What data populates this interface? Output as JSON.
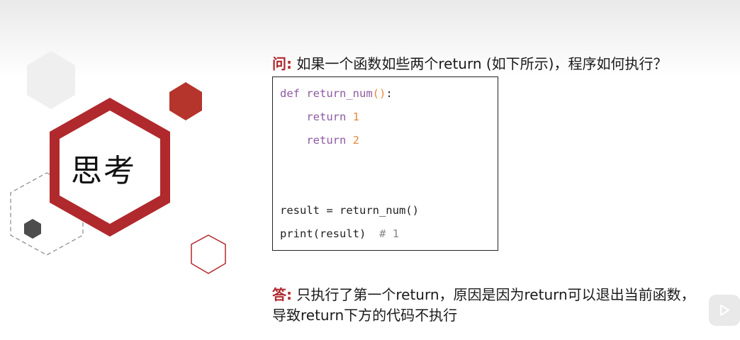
{
  "center_label": "思考",
  "question": {
    "tag": "问:",
    "text": " 如果一个函数如些两个return (如下所示)，程序如何执行？"
  },
  "code": {
    "line1_kw": "def",
    "line1_fn": "return_num",
    "line1_paren": "()",
    "line1_colon": ":",
    "line2_kw": "return",
    "line2_num": "1",
    "line3_kw": "return",
    "line3_num": "2",
    "line4": "result = return_num()",
    "line5": "print(result)",
    "line5_comment": "# 1"
  },
  "answer": {
    "tag": "答:",
    "text1": " 只执行了第一个return，原因是因为return可以退出当前函数，",
    "text2": "导致return下方的代码不执行"
  },
  "colors": {
    "accent_red": "#b0292d",
    "keyword_purple": "#8e5aa0",
    "number_orange": "#e8893a",
    "dark_hex": "#4d4d4d",
    "light_hex": "#efefef"
  },
  "icons": {
    "play": "play-icon"
  }
}
